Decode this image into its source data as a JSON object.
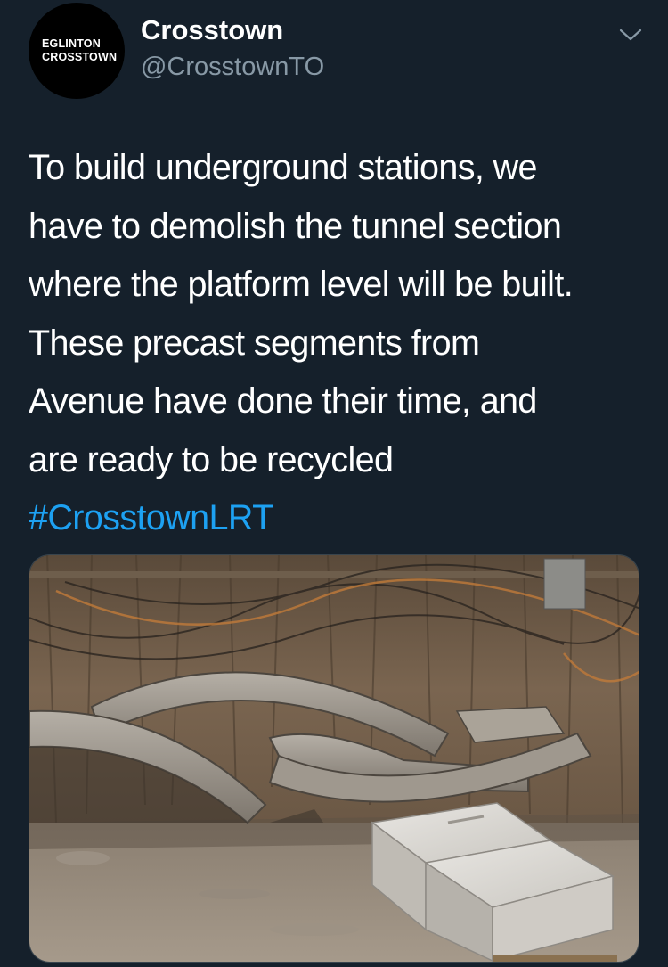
{
  "tweet": {
    "avatar": {
      "line1": "EGLINTON",
      "line2": "CROSSTOWN"
    },
    "author": {
      "display_name": "Crosstown",
      "handle": "@CrosstownTO"
    },
    "text_lines": [
      "To build underground stations, we",
      "have to demolish the tunnel section",
      "where the platform level will be built.",
      "These precast segments from",
      "Avenue have done their time, and",
      "are ready to be recycled"
    ],
    "hashtag": "#CrosstownLRT",
    "colors": {
      "background": "#15202b",
      "text": "#ffffff",
      "secondary": "#8899a6",
      "link": "#1da1f2"
    },
    "icons": {
      "menu": "chevron-down-icon"
    }
  }
}
